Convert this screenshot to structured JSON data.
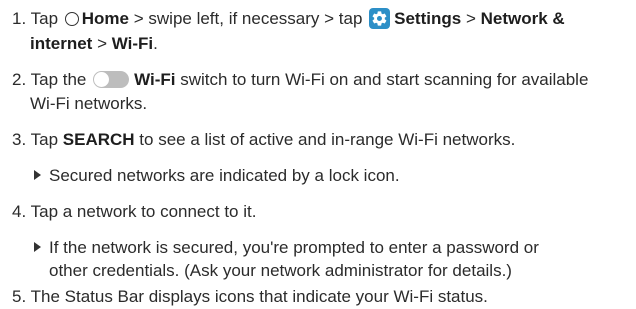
{
  "steps": [
    {
      "num": "1.",
      "line1": {
        "a": "Tap",
        "home": "Home",
        "b": "> swipe left, if necessary > tap",
        "settings": "Settings",
        "c": ">",
        "network": "Network &"
      },
      "line2": {
        "internet": "internet",
        "sep": ">",
        "wifi": "Wi-Fi",
        "end": "."
      }
    },
    {
      "num": "2.",
      "line1": {
        "a": "Tap the",
        "wifi": "Wi-Fi",
        "b": "switch to turn Wi-Fi on and start scanning for available"
      },
      "line2": "Wi-Fi networks."
    },
    {
      "num": "3.",
      "line1": {
        "a": "Tap",
        "search": "SEARCH",
        "b": "to see a list of active and in-range Wi-Fi networks."
      },
      "bullet": "Secured networks are indicated by a lock icon."
    },
    {
      "num": "4.",
      "line1": "Tap a network to connect to it.",
      "bullet1": "If the network is secured, you're prompted to enter a password or",
      "bullet2": "other credentials. (Ask your network administrator for details.)"
    },
    {
      "num": "5.",
      "line1": "The Status Bar displays icons that indicate your Wi-Fi status."
    }
  ],
  "icons": {
    "home": "home-circle-icon",
    "settings": "gear-icon",
    "switch": "toggle-switch-off-icon",
    "bullet": "triangle-bullet-icon"
  },
  "colors": {
    "settings_icon_bg": "#2d8fc7",
    "switch_off": "#bdbdbd"
  }
}
